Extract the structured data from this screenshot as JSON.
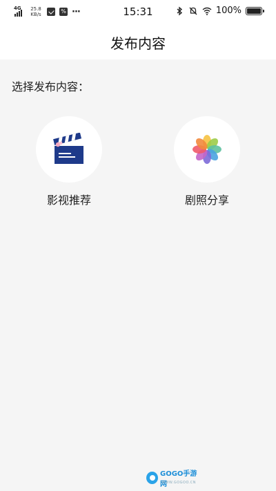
{
  "status_bar": {
    "network": "4G",
    "speed_value": "25.8",
    "speed_unit": "KB/s",
    "app_badge": "%",
    "more_dots": "···",
    "time": "15:31",
    "battery_text": "100%"
  },
  "header": {
    "title": "发布内容"
  },
  "main": {
    "section_label": "选择发布内容：",
    "options": [
      {
        "label": "影视推荐",
        "icon": "clapperboard-icon"
      },
      {
        "label": "剧照分享",
        "icon": "photos-flower-icon"
      }
    ]
  },
  "watermark": {
    "text": "GOGO手游网",
    "sub": "WWW.GOGOO.CN"
  },
  "colors": {
    "background": "#f5f5f5",
    "header_bg": "#ffffff",
    "clapper_blue": "#1e3a8a"
  }
}
